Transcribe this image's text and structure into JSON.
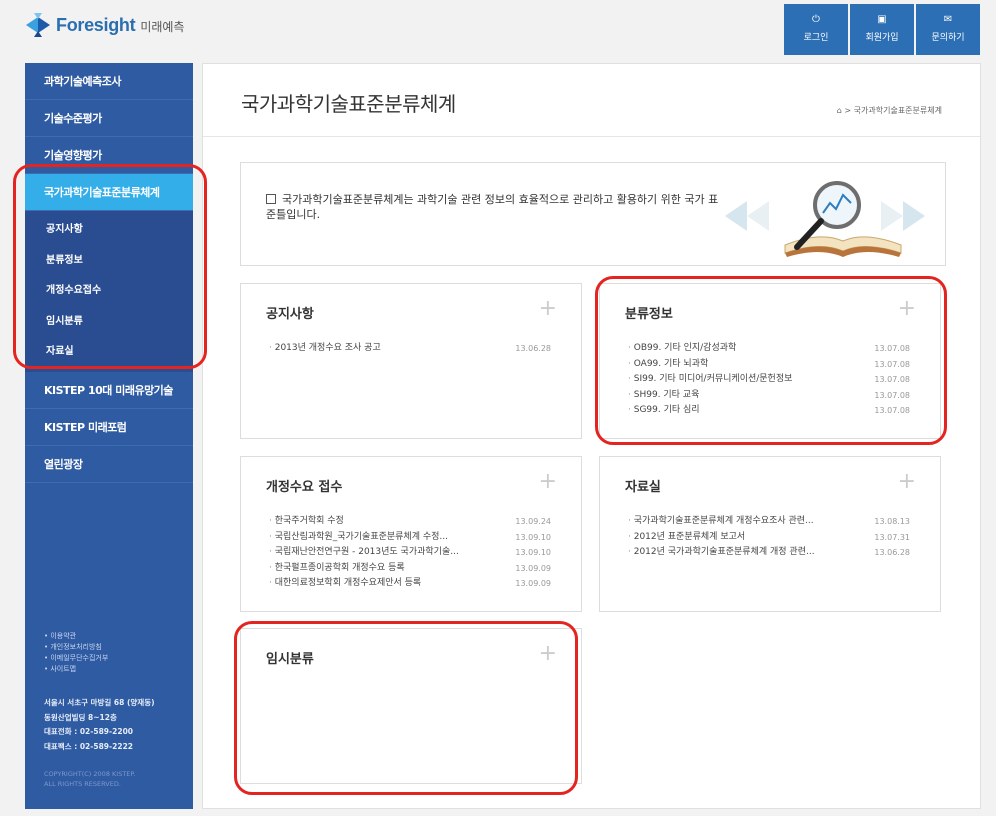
{
  "header": {
    "logo_name": "Foresight",
    "logo_sub": "미래예측",
    "nav": [
      {
        "icon": "power-icon",
        "glyph": "⏻",
        "label": "로그인"
      },
      {
        "icon": "id-card-icon",
        "glyph": "▣",
        "label": "회원가입"
      },
      {
        "icon": "mail-icon",
        "glyph": "✉",
        "label": "문의하기"
      }
    ]
  },
  "sidebar": {
    "items_top": [
      "과학기술예측조사",
      "기술수준평가",
      "기술영향평가"
    ],
    "active": "국가과학기술표준분류체계",
    "sub_items": [
      "공지사항",
      "분류정보",
      "개정수요접수",
      "임시분류",
      "자료실"
    ],
    "items_bottom": [
      "KISTEP 10대 미래유망기술",
      "KISTEP 미래포럼",
      "열린광장"
    ],
    "links": [
      "• 이용약관",
      "• 개인정보처리방침",
      "• 이메일무단수집거부",
      "• 사이트맵"
    ],
    "address": [
      "서울시 서초구 마방길 68 (양재동)",
      "동원산업빌딩 8~12층",
      "대표전화 : 02-589-2200",
      "대표팩스 : 02-589-2222"
    ],
    "copyright": [
      "COPYRIGHT(C) 2008 KISTEP.",
      "ALL RIGHTS RESERVED."
    ]
  },
  "main": {
    "title": "국가과학기술표준분류체계",
    "breadcrumb": "> 국가과학기술표준분류체계",
    "intro": "국가과학기술표준분류체계는 과학기술 관련 정보의 효율적으로 관리하고 활용하기 위한 국가 표준틀입니다.",
    "panels": {
      "notice": {
        "title": "공지사항",
        "items": [
          {
            "text": "2013년 개정수요 조사 공고",
            "date": "13.06.28"
          }
        ]
      },
      "classification": {
        "title": "분류정보",
        "items": [
          {
            "text": "OB99. 기타 인지/감성과학",
            "date": "13.07.08"
          },
          {
            "text": "OA99. 기타 뇌과학",
            "date": "13.07.08"
          },
          {
            "text": "SI99. 기타 미디어/커뮤니케이션/문헌정보",
            "date": "13.07.08"
          },
          {
            "text": "SH99. 기타 교육",
            "date": "13.07.08"
          },
          {
            "text": "SG99. 기타 심리",
            "date": "13.07.08"
          }
        ]
      },
      "revision": {
        "title": "개정수요 접수",
        "items": [
          {
            "text": "한국주거학회 수정",
            "date": "13.09.24"
          },
          {
            "text": "국립산림과학원_국가기술표준분류체계 수정...",
            "date": "13.09.10"
          },
          {
            "text": "국립재난안전연구원 - 2013년도 국가과학기술...",
            "date": "13.09.10"
          },
          {
            "text": "한국펄프종이공학회 개정수요 등록",
            "date": "13.09.09"
          },
          {
            "text": "대한의료정보학회 개정수요제안서 등록",
            "date": "13.09.09"
          }
        ]
      },
      "archive": {
        "title": "자료실",
        "items": [
          {
            "text": "국가과학기술표준분류체계 개정수요조사 관련...",
            "date": "13.08.13"
          },
          {
            "text": "2012년 표준분류체계 보고서",
            "date": "13.07.31"
          },
          {
            "text": "2012년 국가과학기술표준분류체계 개정 관련...",
            "date": "13.06.28"
          }
        ]
      },
      "temporary": {
        "title": "임시분류",
        "items": []
      }
    }
  },
  "colors": {
    "sidebar": "#2f5ba3",
    "active": "#33aee9",
    "submenu": "#2a4d91",
    "top_button": "#2d6fb4",
    "highlight": "#e32421"
  }
}
